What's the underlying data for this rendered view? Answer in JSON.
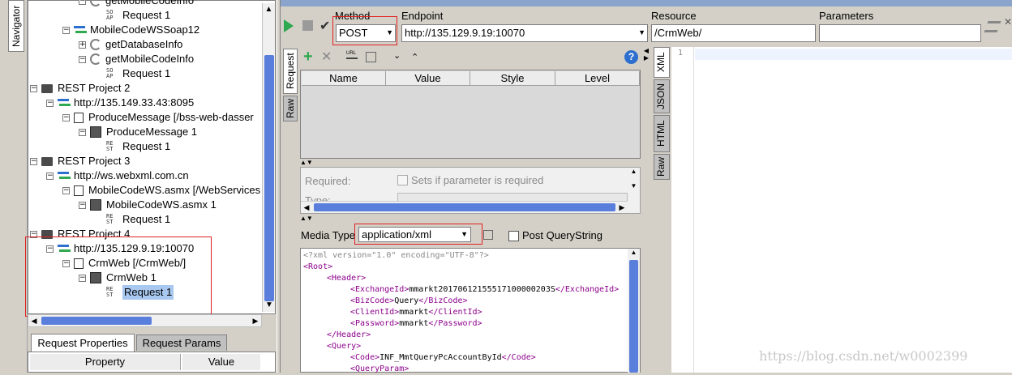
{
  "navigator_tab": "Navigator",
  "tree": [
    {
      "label": "getMobileCodeInfo",
      "indent": 3,
      "icon": "cycle",
      "exp": "minus"
    },
    {
      "label": "Request 1",
      "indent": 5,
      "icon": "soap"
    },
    {
      "label": "MobileCodeWSSoap12",
      "indent": 2,
      "icon": "arrows",
      "exp": "minus"
    },
    {
      "label": "getDatabaseInfo",
      "indent": 3,
      "icon": "cycle",
      "exp": "plus"
    },
    {
      "label": "getMobileCodeInfo",
      "indent": 3,
      "icon": "cycle",
      "exp": "minus"
    },
    {
      "label": "Request 1",
      "indent": 5,
      "icon": "soap"
    },
    {
      "label": "REST Project 2",
      "indent": 0,
      "icon": "folder",
      "exp": "minus"
    },
    {
      "label": "http://135.149.33.43:8095",
      "indent": 1,
      "icon": "arrows",
      "exp": "minus"
    },
    {
      "label": "ProduceMessage [/bss-web-dasser",
      "indent": 2,
      "icon": "doc",
      "exp": "minus"
    },
    {
      "label": "ProduceMessage 1",
      "indent": 3,
      "icon": "grid",
      "exp": "minus"
    },
    {
      "label": "Request 1",
      "indent": 5,
      "icon": "rest"
    },
    {
      "label": "REST Project 3",
      "indent": 0,
      "icon": "folder",
      "exp": "minus"
    },
    {
      "label": "http://ws.webxml.com.cn",
      "indent": 1,
      "icon": "arrows",
      "exp": "minus"
    },
    {
      "label": "MobileCodeWS.asmx [/WebServices",
      "indent": 2,
      "icon": "doc",
      "exp": "minus"
    },
    {
      "label": "MobileCodeWS.asmx 1",
      "indent": 3,
      "icon": "grid",
      "exp": "minus"
    },
    {
      "label": "Request 1",
      "indent": 5,
      "icon": "rest"
    },
    {
      "label": "REST Project 4",
      "indent": 0,
      "icon": "folder",
      "exp": "minus"
    },
    {
      "label": "http://135.129.9.19:10070",
      "indent": 1,
      "icon": "arrows",
      "exp": "minus"
    },
    {
      "label": "CrmWeb [/CrmWeb/]",
      "indent": 2,
      "icon": "doc",
      "exp": "minus"
    },
    {
      "label": "CrmWeb 1",
      "indent": 3,
      "icon": "grid",
      "exp": "minus"
    },
    {
      "label": "Request 1",
      "indent": 5,
      "icon": "rest",
      "selected": true
    }
  ],
  "bottom_tabs": {
    "request_properties": "Request Properties",
    "request_params": "Request Params"
  },
  "props_table": {
    "property": "Property",
    "value": "Value"
  },
  "toolbar": {
    "method_label": "Method",
    "method_value": "POST",
    "endpoint_label": "Endpoint",
    "endpoint_value": "http://135.129.9.19:10070",
    "resource_label": "Resource",
    "resource_value": "/CrmWeb/",
    "parameters_label": "Parameters",
    "parameters_value": ""
  },
  "side_tabs": {
    "request": "Request",
    "raw": "Raw"
  },
  "params_table": {
    "name": "Name",
    "value": "Value",
    "style": "Style",
    "level": "Level"
  },
  "required": {
    "label": "Required:",
    "checkbox_label": "Sets if parameter is required",
    "type_label": "Type:"
  },
  "media": {
    "label": "Media Type",
    "value": "application/xml",
    "post_qs": "Post QueryString"
  },
  "xml_lines": [
    {
      "indent": 0,
      "pre": "",
      "tag": "",
      "text": "<?xml version=\"1.0\" encoding=\"UTF-8\"?>",
      "decl": true
    },
    {
      "indent": 0,
      "open": "<Root>"
    },
    {
      "indent": 1,
      "open": "<Header>"
    },
    {
      "indent": 2,
      "open": "<ExchangeId>",
      "text": "mmarkt20170612155517100000203S",
      "close": "</ExchangeId>"
    },
    {
      "indent": 2,
      "open": "<BizCode>",
      "text": "Query",
      "close": "</BizCode>"
    },
    {
      "indent": 2,
      "open": "<ClientId>",
      "text": "mmarkt",
      "close": "</ClientId>"
    },
    {
      "indent": 2,
      "open": "<Password>",
      "text": "mmarkt",
      "close": "</Password>"
    },
    {
      "indent": 1,
      "open": "</Header>"
    },
    {
      "indent": 1,
      "open": "<Query>"
    },
    {
      "indent": 2,
      "open": "<Code>",
      "text": "INF_MmtQueryPcAccountById",
      "close": "</Code>"
    },
    {
      "indent": 2,
      "open": "<QueryParam>"
    }
  ],
  "right_tabs": {
    "xml": "XML",
    "json": "JSON",
    "html": "HTML",
    "raw": "Raw"
  },
  "line_number": "1",
  "watermark": "https://blog.csdn.net/w0002399",
  "colors": {
    "accent_red": "#e02020",
    "selected_bg": "#3875d7",
    "tag_color": "#8b008b",
    "scroll_blue": "#5a7edc"
  }
}
